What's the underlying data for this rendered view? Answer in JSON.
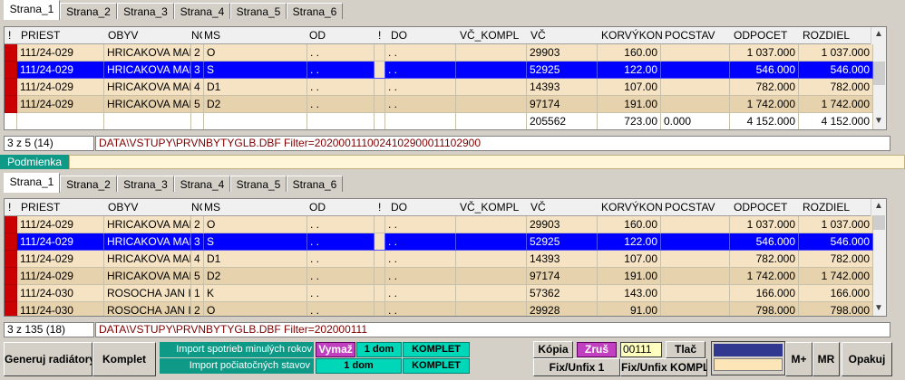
{
  "tabs": [
    "Strana_1",
    "Strana_2",
    "Strana_3",
    "Strana_4",
    "Strana_5",
    "Strana_6"
  ],
  "columns": [
    "!",
    "PRIEST",
    "OBYV",
    "NC",
    "MS",
    "OD",
    "!",
    "DO",
    "VČ_KOMPL",
    "VČ",
    "KORVÝKON",
    "POCSTAV",
    "ODPOCET",
    "ROZDIEL"
  ],
  "grid1": {
    "rows": [
      {
        "priest": "111/24-029",
        "obyv": "HRICAKOVA MAR",
        "nc": "2",
        "ms": "O",
        "od": ". .",
        "do": ". .",
        "vc_kompl": "",
        "vc": "29903",
        "korvykon": "160.00",
        "pocstav": "",
        "odpocet": "1 037.000",
        "rozdiel": "1 037.000"
      },
      {
        "priest": "111/24-029",
        "obyv": "HRICAKOVA MAR",
        "nc": "3",
        "ms": "S",
        "od": ". .",
        "do": ". .",
        "vc_kompl": "",
        "vc": "52925",
        "korvykon": "122.00",
        "pocstav": "",
        "odpocet": "546.000",
        "rozdiel": "546.000"
      },
      {
        "priest": "111/24-029",
        "obyv": "HRICAKOVA MAR",
        "nc": "4",
        "ms": "D1",
        "od": ". .",
        "do": ". .",
        "vc_kompl": "",
        "vc": "14393",
        "korvykon": "107.00",
        "pocstav": "",
        "odpocet": "782.000",
        "rozdiel": "782.000"
      },
      {
        "priest": "111/24-029",
        "obyv": "HRICAKOVA MAR",
        "nc": "5",
        "ms": "D2",
        "od": ". .",
        "do": ". .",
        "vc_kompl": "",
        "vc": "97174",
        "korvykon": "191.00",
        "pocstav": "",
        "odpocet": "1 742.000",
        "rozdiel": "1 742.000"
      }
    ],
    "totals": {
      "vc": "205562",
      "korvykon": "723.00",
      "pocstav": "0.000",
      "odpocet": "4 152.000",
      "rozdiel": "4 152.000"
    },
    "status_count": "3 z 5 (14)",
    "status_path": "DATA\\VSTUPY\\PRVNBYTYGLB.DBF Filter=2020001110024102900011102900"
  },
  "condition_label": "Podmienka",
  "grid2": {
    "rows": [
      {
        "priest": "111/24-029",
        "obyv": "HRICAKOVA MAR",
        "nc": "2",
        "ms": "O",
        "od": ". .",
        "do": ". .",
        "vc_kompl": "",
        "vc": "29903",
        "korvykon": "160.00",
        "pocstav": "",
        "odpocet": "1 037.000",
        "rozdiel": "1 037.000"
      },
      {
        "priest": "111/24-029",
        "obyv": "HRICAKOVA MAR",
        "nc": "3",
        "ms": "S",
        "od": ". .",
        "do": ". .",
        "vc_kompl": "",
        "vc": "52925",
        "korvykon": "122.00",
        "pocstav": "",
        "odpocet": "546.000",
        "rozdiel": "546.000"
      },
      {
        "priest": "111/24-029",
        "obyv": "HRICAKOVA MAR",
        "nc": "4",
        "ms": "D1",
        "od": ". .",
        "do": ". .",
        "vc_kompl": "",
        "vc": "14393",
        "korvykon": "107.00",
        "pocstav": "",
        "odpocet": "782.000",
        "rozdiel": "782.000"
      },
      {
        "priest": "111/24-029",
        "obyv": "HRICAKOVA MAR",
        "nc": "5",
        "ms": "D2",
        "od": ". .",
        "do": ". .",
        "vc_kompl": "",
        "vc": "97174",
        "korvykon": "191.00",
        "pocstav": "",
        "odpocet": "1 742.000",
        "rozdiel": "1 742.000"
      },
      {
        "priest": "111/24-030",
        "obyv": "ROSOCHA JAN I",
        "nc": "1",
        "ms": "K",
        "od": ". .",
        "do": ". .",
        "vc_kompl": "",
        "vc": "57362",
        "korvykon": "143.00",
        "pocstav": "",
        "odpocet": "166.000",
        "rozdiel": "166.000"
      },
      {
        "priest": "111/24-030",
        "obyv": "ROSOCHA JAN I",
        "nc": "2",
        "ms": "O",
        "od": ". .",
        "do": ". .",
        "vc_kompl": "",
        "vc": "29928",
        "korvykon": "91.00",
        "pocstav": "",
        "odpocet": "798.000",
        "rozdiel": "798.000"
      }
    ],
    "status_count": "3 z 135 (18)",
    "status_path": "DATA\\VSTUPY\\PRVNBYTYGLB.DBF Filter=202000111"
  },
  "toolbar": {
    "generate": "Generuj radiátory",
    "komplet": "Komplet",
    "import_consumption": "Import spotrieb minulých rokov",
    "import_initial": "Import počiatočných stavov",
    "vymaz": "Vymaž",
    "one_house": "1 dom",
    "komplet_small": "KOMPLET",
    "kopia": "Kópia",
    "zrus": "Zruš",
    "code_value": "00111",
    "tlac": "Tlač",
    "fix_unfix_1": "Fix/Unfix 1",
    "fix_unfix_komplet": "Fix/Unfix KOMPLET",
    "m_plus": "M+",
    "mr": "MR",
    "opakuj": "Opakuj"
  },
  "colors": {
    "selection": "#0000ff",
    "row_light": "#f5e3c3",
    "row_dark": "#e6d2ac",
    "marker": "#cc0000",
    "teal": "#00d7b8",
    "violet": "#c040c0",
    "path_text": "#800000"
  }
}
